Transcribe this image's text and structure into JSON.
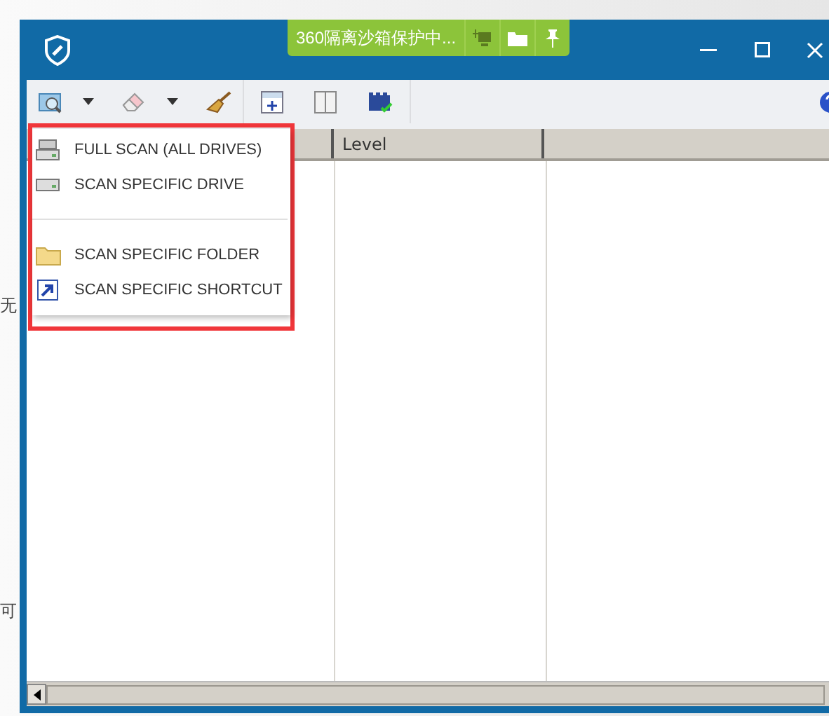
{
  "backdrop": {
    "texts": [
      "无",
      "可"
    ]
  },
  "sandbox_banner": {
    "text": "360隔离沙箱保护中..."
  },
  "scan_menu": {
    "items": [
      {
        "kind": "item",
        "label": "FULL SCAN (ALL DRIVES)"
      },
      {
        "kind": "item",
        "label": "SCAN SPECIFIC DRIVE"
      },
      {
        "kind": "separator"
      },
      {
        "kind": "item",
        "label": "SCAN SPECIFIC FOLDER"
      },
      {
        "kind": "item",
        "label": "SCAN SPECIFIC SHORTCUT"
      }
    ]
  },
  "table": {
    "column_2": "Level"
  }
}
